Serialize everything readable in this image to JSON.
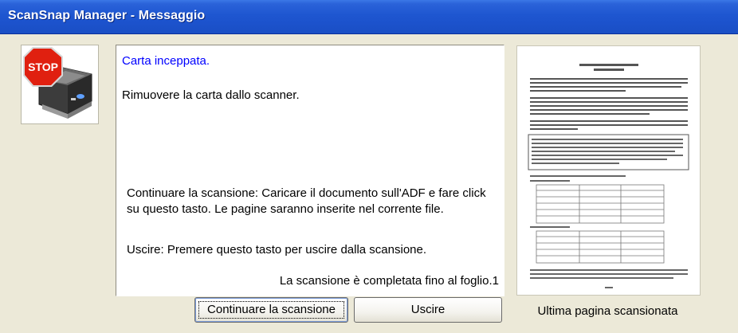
{
  "window": {
    "title": "ScanSnap Manager - Messaggio"
  },
  "stop_sign": {
    "text": "STOP",
    "color": "#e02010"
  },
  "message": {
    "title": "Carta inceppata.",
    "instruction": "Rimuovere la carta dallo scanner.",
    "continue_help": "Continuare la scansione: Caricare il documento sull'ADF e fare click su questo tasto. Le pagine saranno inserite nel corrente file.",
    "exit_help": "Uscire: Premere questo tasto per uscire dalla scansione.",
    "status": "La scansione è completata fino al foglio.1"
  },
  "buttons": {
    "continue_label": "Continuare la scansione",
    "exit_label": "Uscire"
  },
  "preview": {
    "label": "Ultima pagina scansionata"
  },
  "colors": {
    "title_bar": "#1e56d0",
    "dialog_background": "#ece9d8",
    "message_title": "#0000ff"
  }
}
